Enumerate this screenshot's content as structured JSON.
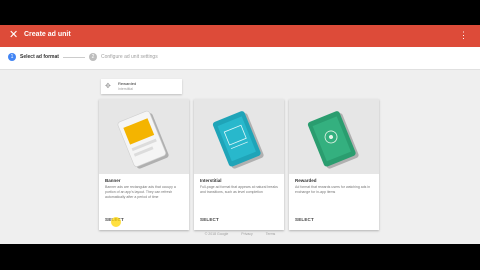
{
  "appbar": {
    "title": "Create ad unit",
    "close_icon": "close-icon",
    "more_icon": "more-vert-icon",
    "color": "#dd4b39"
  },
  "stepper": {
    "steps": [
      {
        "number": "1",
        "label": "Select ad format"
      },
      {
        "number": "2",
        "label": "Configure ad unit settings"
      }
    ]
  },
  "saved_format": {
    "title": "Rewarded",
    "subtitle": "Interstitial"
  },
  "cards": [
    {
      "title": "Banner",
      "description": "Banner ads are rectangular ads that occupy a portion of an app's layout. They can refresh automatically after a period of time",
      "select": "SELECT",
      "accent": "#f4b400"
    },
    {
      "title": "Interstitial",
      "description": "Full-page ad format that appears at natural breaks and transitions, such as level completion",
      "select": "SELECT",
      "accent": "#1fa4b8"
    },
    {
      "title": "Rewarded",
      "description": "Ad format that rewards users for watching ads in exchange for in-app items",
      "select": "SELECT",
      "accent": "#2a9d6f"
    }
  ],
  "footer": {
    "copyright": "© 2018 Google",
    "privacy": "Privacy",
    "terms": "Terms"
  }
}
